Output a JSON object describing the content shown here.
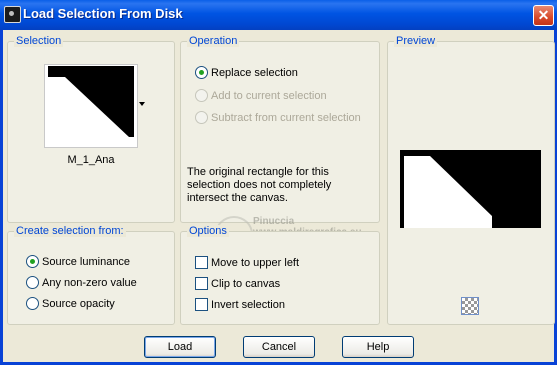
{
  "window": {
    "title": "Load Selection From Disk",
    "close_glyph": "✕"
  },
  "selection_group": {
    "legend": "Selection",
    "selected_name": "M_1_Ana"
  },
  "operation_group": {
    "legend": "Operation",
    "options": [
      {
        "label": "Replace selection",
        "checked": true,
        "enabled": true
      },
      {
        "label": "Add to current selection",
        "checked": false,
        "enabled": false
      },
      {
        "label": "Subtract from current selection",
        "checked": false,
        "enabled": false
      }
    ],
    "note": "The original rectangle for this selection does not completely intersect the canvas."
  },
  "watermark": {
    "line1": "Pinuccia",
    "line2": "www.maldiregrafica.eu"
  },
  "preview_group": {
    "legend": "Preview"
  },
  "create_group": {
    "legend": "Create selection from:",
    "options": [
      {
        "label": "Source luminance",
        "checked": true
      },
      {
        "label": "Any non-zero value",
        "checked": false
      },
      {
        "label": "Source opacity",
        "checked": false
      }
    ]
  },
  "options_group": {
    "legend": "Options",
    "checks": [
      {
        "label": "Move to upper left",
        "checked": false
      },
      {
        "label": "Clip to canvas",
        "checked": false
      },
      {
        "label": "Invert selection",
        "checked": false
      }
    ]
  },
  "buttons": {
    "load": "Load",
    "cancel": "Cancel",
    "help": "Help"
  },
  "colors": {
    "title_bar": "#0054e3",
    "legend_text": "#0046d5",
    "dialog_bg": "#ece9d8",
    "radio_dot": "#21a121"
  },
  "icons": {
    "app": "app-icon",
    "close": "close-icon",
    "dropdown": "chevron-down-icon",
    "transparency_grid": "transparency-grid-icon"
  }
}
